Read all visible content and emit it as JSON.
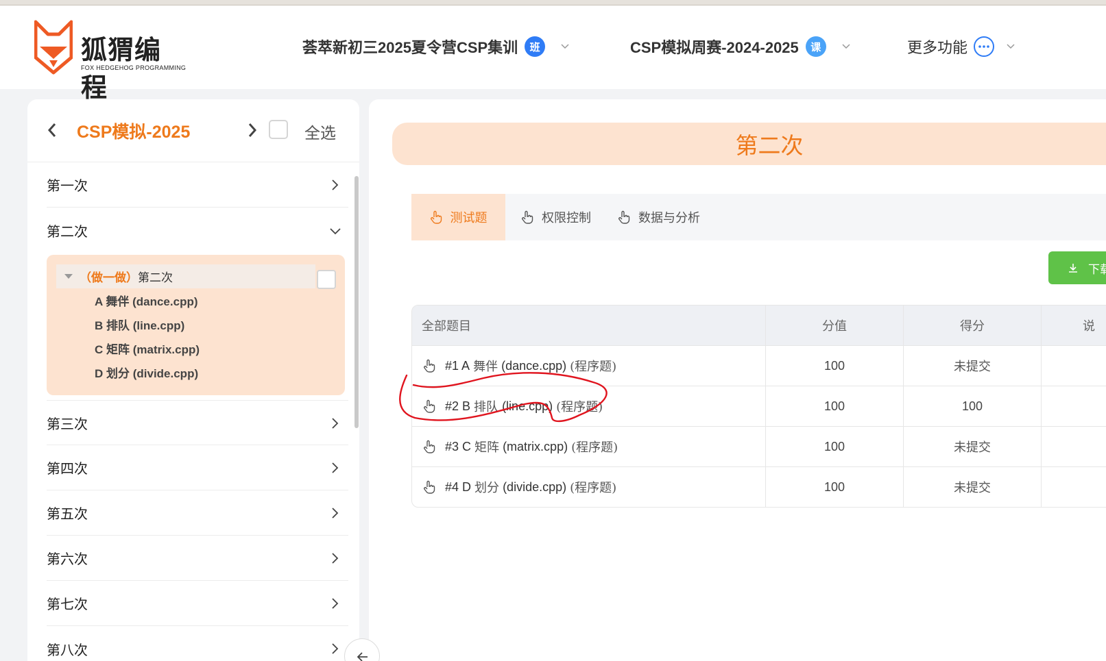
{
  "header": {
    "logo_text": "狐猬编程",
    "logo_sub": "FOX HEDGEHOG PROGRAMMING",
    "nav": [
      {
        "label": "荟萃新初三2025夏令营CSP集训",
        "badge": "班"
      },
      {
        "label": "CSP模拟周赛-2024-2025",
        "badge": "课"
      },
      {
        "label": "更多功能"
      }
    ]
  },
  "sidebar": {
    "title": "CSP模拟-2025",
    "select_all": "全选",
    "items": [
      {
        "label": "第一次"
      },
      {
        "label": "第二次"
      },
      {
        "label": "第三次"
      },
      {
        "label": "第四次"
      },
      {
        "label": "第五次"
      },
      {
        "label": "第六次"
      },
      {
        "label": "第七次"
      },
      {
        "label": "第八次"
      }
    ],
    "expanded": {
      "tag": "（做一做）",
      "name": "第二次",
      "problems": [
        "A 舞伴 (dance.cpp)",
        "B 排队 (line.cpp)",
        "C 矩阵 (matrix.cpp)",
        "D 划分 (divide.cpp)"
      ]
    }
  },
  "main": {
    "banner": "第二次",
    "tabs": [
      "测试题",
      "权限控制",
      "数据与分析"
    ],
    "download_label": "下载",
    "table": {
      "headers": [
        "全部题目",
        "分值",
        "得分",
        "说"
      ],
      "rows": [
        {
          "id": "#1 A",
          "name": "舞伴",
          "file": "(dance.cpp)",
          "type": "(程序题)",
          "score": "100",
          "got": "未提交"
        },
        {
          "id": "#2 B",
          "name": "排队",
          "file": "(line.cpp)",
          "type": "(程序题)",
          "score": "100",
          "got": "100"
        },
        {
          "id": "#3 C",
          "name": "矩阵",
          "file": "(matrix.cpp)",
          "type": "(程序题)",
          "score": "100",
          "got": "未提交"
        },
        {
          "id": "#4 D",
          "name": "划分",
          "file": "(divide.cpp)",
          "type": "(程序题)",
          "score": "100",
          "got": "未提交"
        }
      ]
    }
  },
  "colors": {
    "accent": "#ee7a1c",
    "badge": "#2f7cf6",
    "green": "#5fc248",
    "circle": "#e0141e"
  }
}
